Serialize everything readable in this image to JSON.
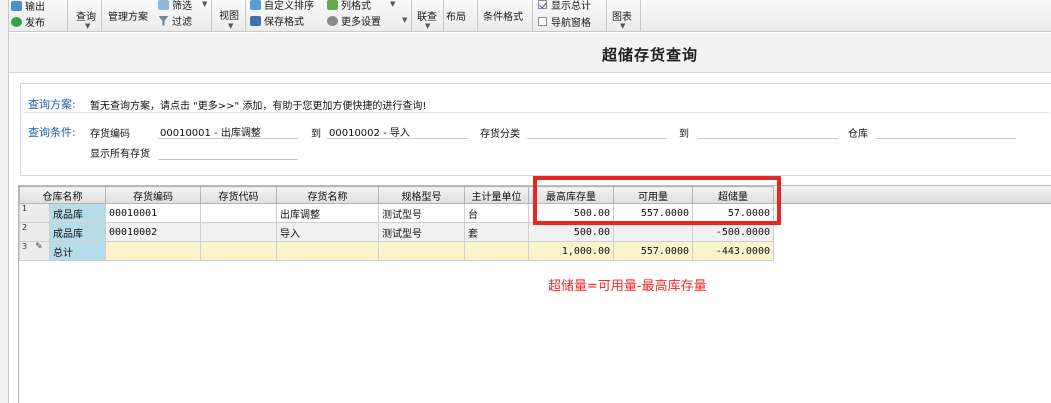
{
  "ribbon": {
    "export_label": "输出",
    "publish_label": "发布",
    "query_label": "查询",
    "manage_plan_label": "管理方案",
    "filter_top_label": "筛选",
    "filter_label": "过滤",
    "view_label": "视图",
    "custom_sort_label": "自定义排序",
    "save_format_label": "保存格式",
    "column_format_label": "列格式",
    "more_settings_label": "更多设置",
    "link_query_label": "联查",
    "layout_label": "布局",
    "conditional_format_label": "条件格式",
    "show_total_label": "显示总计",
    "show_total_checked": true,
    "nav_pane_label": "导航窗格",
    "nav_pane_checked": false,
    "chart_label": "图表"
  },
  "page": {
    "title": "超储存货查询"
  },
  "query": {
    "plan_label": "查询方案:",
    "plan_message": "暂无查询方案，请点击 \"更多>>\" 添加，有助于您更加方便快捷的进行查询!",
    "condition_label": "查询条件:",
    "inv_code_label": "存货编码",
    "inv_code_from": "00010001 - 出库调整",
    "to_label": "到",
    "inv_code_to": "00010002 - 导入",
    "inv_category_label": "存货分类",
    "inv_category_from": "",
    "inv_category_to_label": "到",
    "inv_category_to": "",
    "warehouse_label": "仓库",
    "warehouse_value": "",
    "show_all_label": "显示所有存货",
    "show_all_value": ""
  },
  "grid": {
    "columns": [
      "仓库名称",
      "存货编码",
      "存货代码",
      "存货名称",
      "规格型号",
      "主计量单位",
      "最高库存量",
      "可用量",
      "超储量"
    ],
    "rows": [
      {
        "num": "1",
        "warehouse": "成品库",
        "inv_code": "00010001",
        "inv_alias": "",
        "inv_name": "出库调整",
        "spec": "测试型号",
        "unit": "台",
        "max_stock": "500.00",
        "available": "557.0000",
        "overstock": "57.0000"
      },
      {
        "num": "2",
        "warehouse": "成品库",
        "inv_code": "00010002",
        "inv_alias": "",
        "inv_name": "导入",
        "spec": "测试型号",
        "unit": "套",
        "max_stock": "500.00",
        "available": "",
        "overstock": "-500.0000"
      },
      {
        "num": "3",
        "warehouse": "总计",
        "inv_code": "",
        "inv_alias": "",
        "inv_name": "",
        "spec": "",
        "unit": "",
        "max_stock": "1,000.00",
        "available": "557.0000",
        "overstock": "-443.0000"
      }
    ]
  },
  "annotation": {
    "formula": "超储量=可用量-最高库存量"
  },
  "colors": {
    "highlight_box": "#e8261f",
    "annotation_text": "#ef2a2a",
    "warehouse_cell": "#b7dcea",
    "total_row": "#fbf3c9",
    "label_blue": "#1f5fa9"
  }
}
